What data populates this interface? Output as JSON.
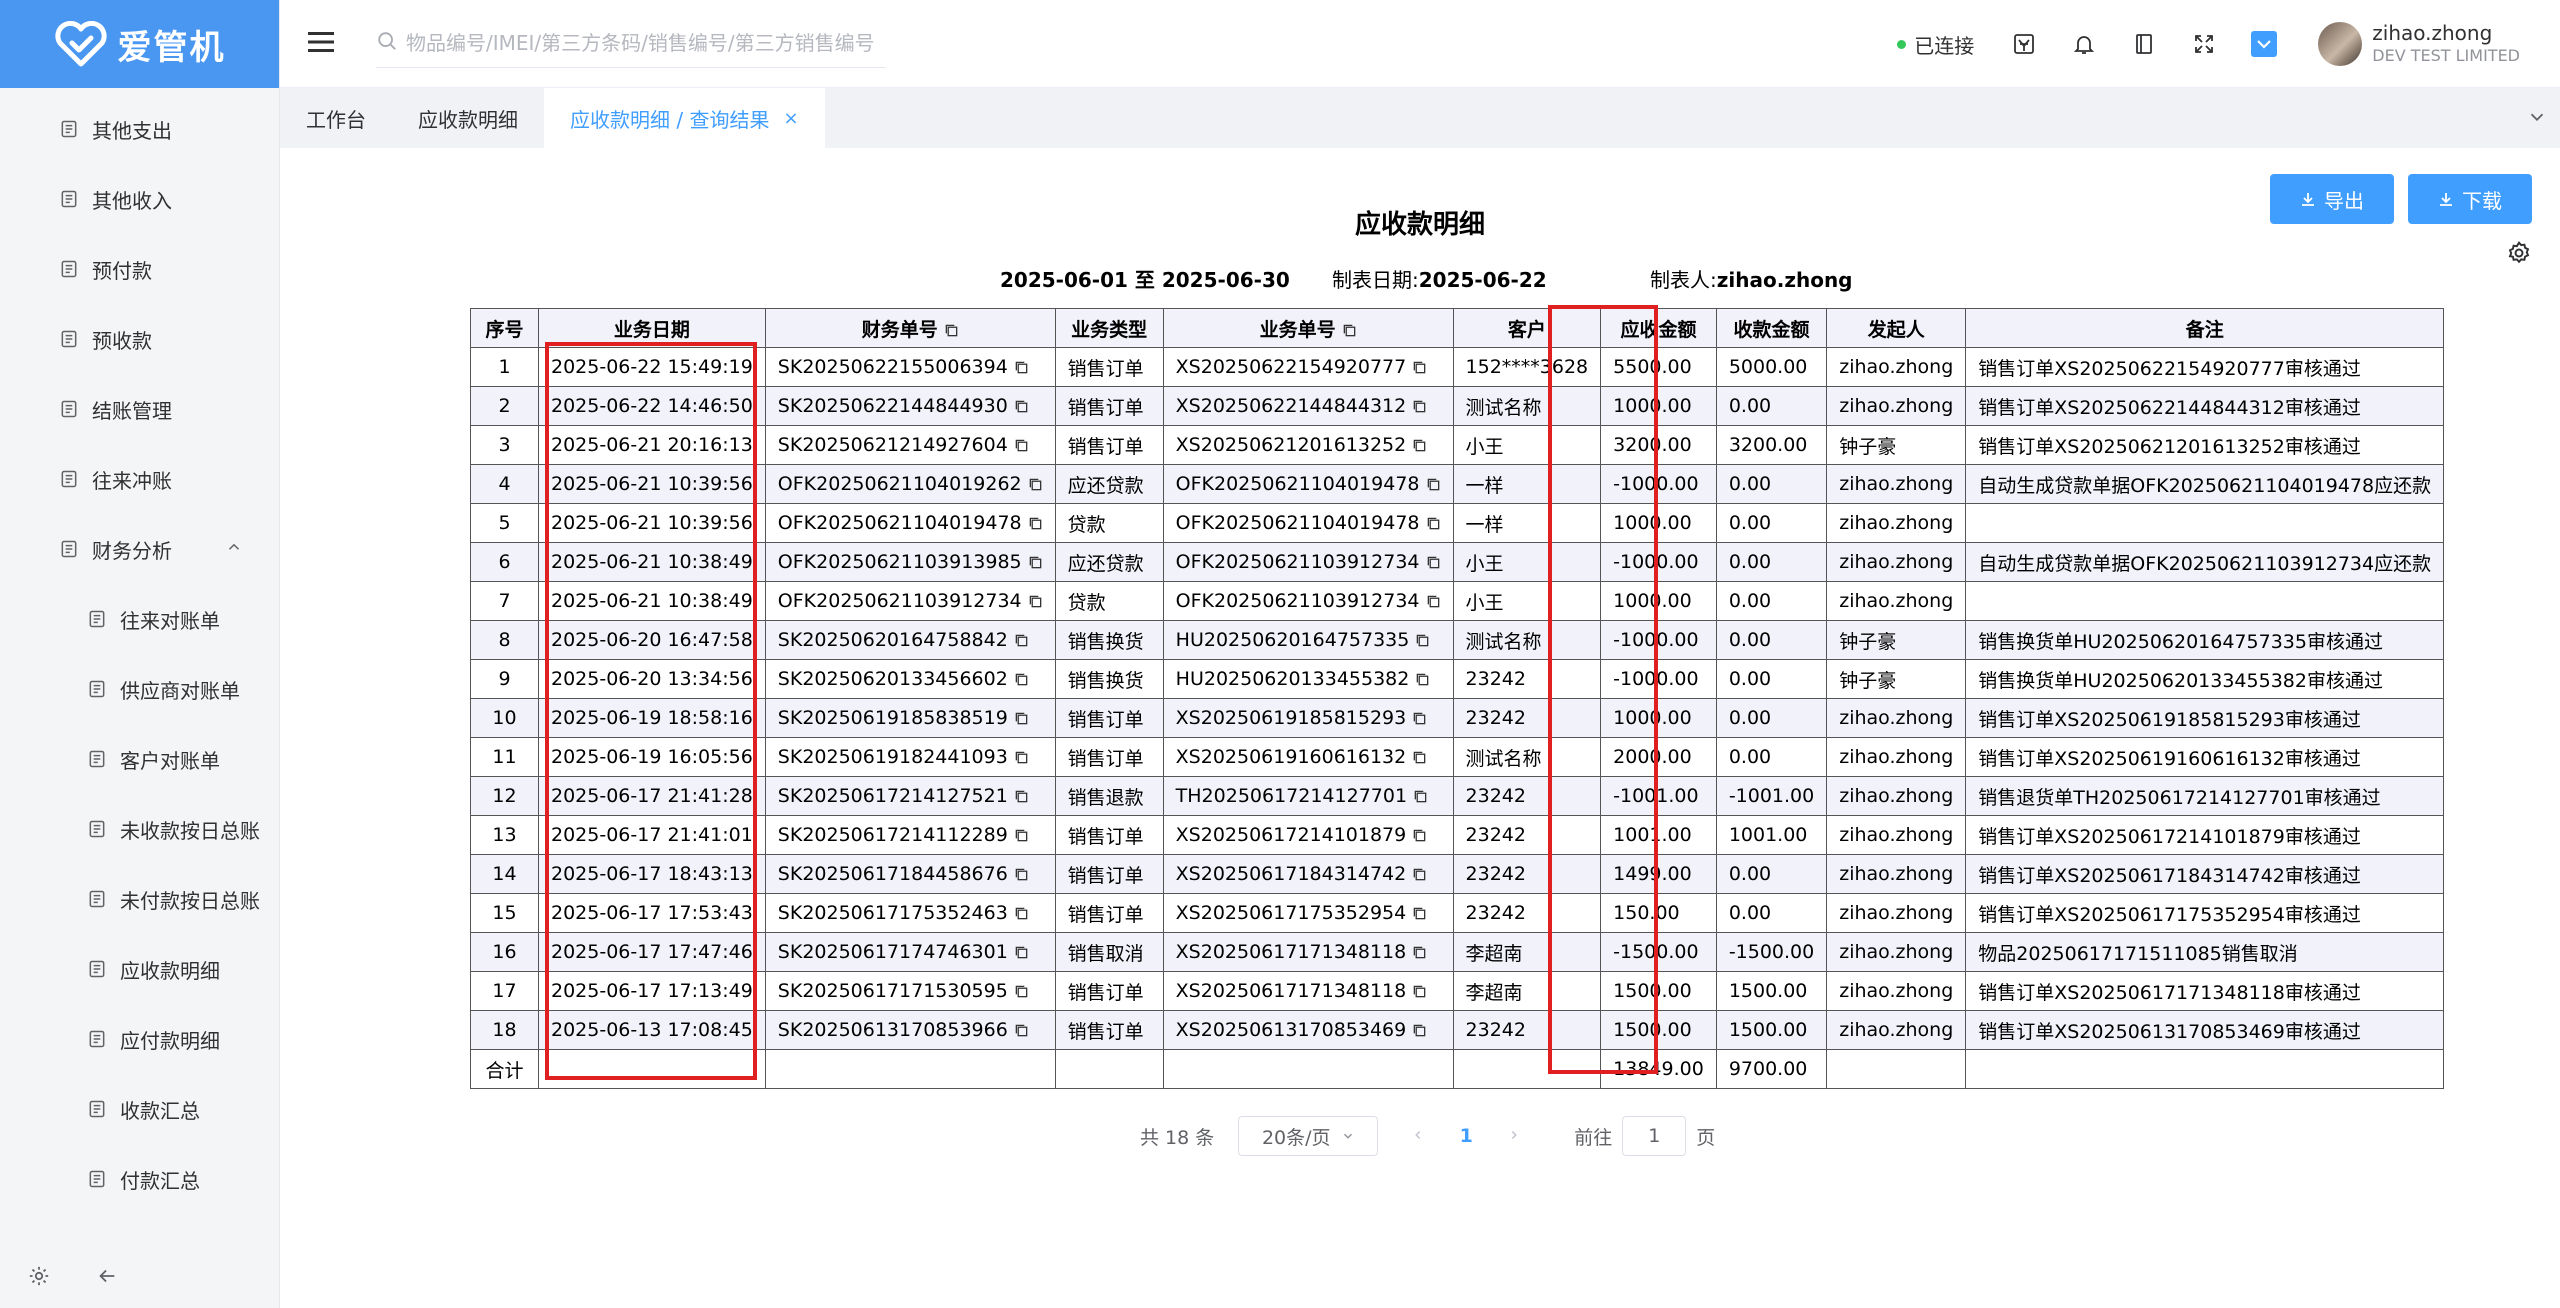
{
  "app": {
    "name": "爱管机"
  },
  "sidebar": {
    "items": [
      {
        "label": "其他支出",
        "icon": "expense-icon"
      },
      {
        "label": "其他收入",
        "icon": "income-icon"
      },
      {
        "label": "预付款",
        "icon": "prepay-icon"
      },
      {
        "label": "预收款",
        "icon": "prereceive-icon"
      },
      {
        "label": "结账管理",
        "icon": "history-icon"
      },
      {
        "label": "往来冲账",
        "icon": "link-icon"
      },
      {
        "label": "财务分析",
        "icon": "chart-icon",
        "expanded": true
      }
    ],
    "subitems": [
      {
        "label": "往来对账单"
      },
      {
        "label": "供应商对账单"
      },
      {
        "label": "客户对账单"
      },
      {
        "label": "未收款按日总账"
      },
      {
        "label": "未付款按日总账"
      },
      {
        "label": "应收款明细"
      },
      {
        "label": "应付款明细"
      },
      {
        "label": "收款汇总"
      },
      {
        "label": "付款汇总"
      }
    ]
  },
  "header": {
    "search_placeholder": "物品编号/IMEI/第三方条码/销售编号/第三方销售编号",
    "status": "已连接",
    "user_name": "zihao.zhong",
    "user_org": "DEV TEST LIMITED"
  },
  "tabs": [
    {
      "label": "工作台",
      "active": false
    },
    {
      "label": "应收款明细",
      "active": false
    },
    {
      "label": "应收款明细 / 查询结果",
      "active": true,
      "close": "×"
    }
  ],
  "toolbar": {
    "export_label": "导出",
    "download_label": "下载"
  },
  "report": {
    "title": "应收款明细",
    "date_range": "2025-06-01 至 2025-06-30",
    "made_date_label": "制表日期:",
    "made_date": "2025-06-22",
    "maker_label": "制表人:",
    "maker": "zihao.zhong",
    "columns": [
      "序号",
      "业务日期",
      "财务单号",
      "业务类型",
      "业务单号",
      "客户",
      "应收金额",
      "收款金额",
      "发起人",
      "备注"
    ],
    "rows": [
      [
        "1",
        "2025-06-22 15:49:19",
        "SK20250622155006394",
        "销售订单",
        "XS20250622154920777",
        "152****3628",
        "5500.00",
        "5000.00",
        "zihao.zhong",
        "销售订单XS20250622154920777审核通过"
      ],
      [
        "2",
        "2025-06-22 14:46:50",
        "SK20250622144844930",
        "销售订单",
        "XS20250622144844312",
        "测试名称",
        "1000.00",
        "0.00",
        "zihao.zhong",
        "销售订单XS20250622144844312审核通过"
      ],
      [
        "3",
        "2025-06-21 20:16:13",
        "SK20250621214927604",
        "销售订单",
        "XS20250621201613252",
        "小王",
        "3200.00",
        "3200.00",
        "钟子豪",
        "销售订单XS20250621201613252审核通过"
      ],
      [
        "4",
        "2025-06-21 10:39:56",
        "OFK20250621104019262",
        "应还贷款",
        "OFK20250621104019478",
        "一样",
        "-1000.00",
        "0.00",
        "zihao.zhong",
        "自动生成贷款单据OFK20250621104019478应还款"
      ],
      [
        "5",
        "2025-06-21 10:39:56",
        "OFK20250621104019478",
        "贷款",
        "OFK20250621104019478",
        "一样",
        "1000.00",
        "0.00",
        "zihao.zhong",
        ""
      ],
      [
        "6",
        "2025-06-21 10:38:49",
        "OFK20250621103913985",
        "应还贷款",
        "OFK20250621103912734",
        "小王",
        "-1000.00",
        "0.00",
        "zihao.zhong",
        "自动生成贷款单据OFK20250621103912734应还款"
      ],
      [
        "7",
        "2025-06-21 10:38:49",
        "OFK20250621103912734",
        "贷款",
        "OFK20250621103912734",
        "小王",
        "1000.00",
        "0.00",
        "zihao.zhong",
        ""
      ],
      [
        "8",
        "2025-06-20 16:47:58",
        "SK20250620164758842",
        "销售换货",
        "HU20250620164757335",
        "测试名称",
        "-1000.00",
        "0.00",
        "钟子豪",
        "销售换货单HU20250620164757335审核通过"
      ],
      [
        "9",
        "2025-06-20 13:34:56",
        "SK20250620133456602",
        "销售换货",
        "HU20250620133455382",
        "23242",
        "-1000.00",
        "0.00",
        "钟子豪",
        "销售换货单HU20250620133455382审核通过"
      ],
      [
        "10",
        "2025-06-19 18:58:16",
        "SK20250619185838519",
        "销售订单",
        "XS20250619185815293",
        "23242",
        "1000.00",
        "0.00",
        "zihao.zhong",
        "销售订单XS20250619185815293审核通过"
      ],
      [
        "11",
        "2025-06-19 16:05:56",
        "SK20250619182441093",
        "销售订单",
        "XS20250619160616132",
        "测试名称",
        "2000.00",
        "0.00",
        "zihao.zhong",
        "销售订单XS20250619160616132审核通过"
      ],
      [
        "12",
        "2025-06-17 21:41:28",
        "SK20250617214127521",
        "销售退款",
        "TH20250617214127701",
        "23242",
        "-1001.00",
        "-1001.00",
        "zihao.zhong",
        "销售退货单TH20250617214127701审核通过"
      ],
      [
        "13",
        "2025-06-17 21:41:01",
        "SK20250617214112289",
        "销售订单",
        "XS20250617214101879",
        "23242",
        "1001.00",
        "1001.00",
        "zihao.zhong",
        "销售订单XS20250617214101879审核通过"
      ],
      [
        "14",
        "2025-06-17 18:43:13",
        "SK20250617184458676",
        "销售订单",
        "XS20250617184314742",
        "23242",
        "1499.00",
        "0.00",
        "zihao.zhong",
        "销售订单XS20250617184314742审核通过"
      ],
      [
        "15",
        "2025-06-17 17:53:43",
        "SK20250617175352463",
        "销售订单",
        "XS20250617175352954",
        "23242",
        "150.00",
        "0.00",
        "zihao.zhong",
        "销售订单XS20250617175352954审核通过"
      ],
      [
        "16",
        "2025-06-17 17:47:46",
        "SK20250617174746301",
        "销售取消",
        "XS20250617171348118",
        "李超南",
        "-1500.00",
        "-1500.00",
        "zihao.zhong",
        "物品20250617171511085销售取消"
      ],
      [
        "17",
        "2025-06-17 17:13:49",
        "SK20250617171530595",
        "销售订单",
        "XS20250617171348118",
        "李超南",
        "1500.00",
        "1500.00",
        "zihao.zhong",
        "销售订单XS20250617171348118审核通过"
      ],
      [
        "18",
        "2025-06-13 17:08:45",
        "SK20250613170853966",
        "销售订单",
        "XS20250613170853469",
        "23242",
        "1500.00",
        "1500.00",
        "zihao.zhong",
        "销售订单XS20250613170853469审核通过"
      ]
    ],
    "total_row": {
      "label": "合计",
      "receivable": "13849.00",
      "received": "9700.00"
    }
  },
  "pagination": {
    "total": "共 18 条",
    "page_size": "20条/页",
    "current_page": "1",
    "goto_label": "前往",
    "goto_value": "1",
    "goto_suffix": "页"
  },
  "colors": {
    "accent": "#409eff",
    "logo_bg": "#4a97f2",
    "highlight": "#e02020"
  }
}
